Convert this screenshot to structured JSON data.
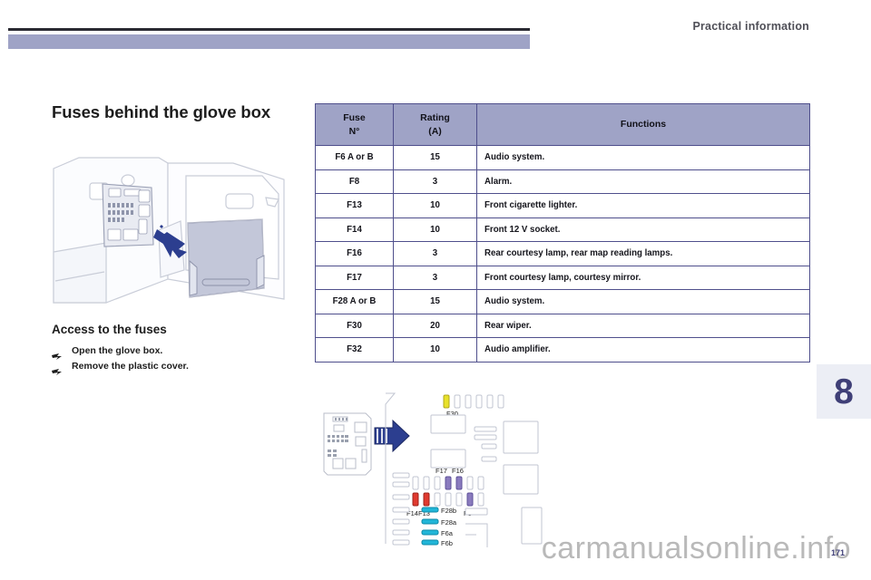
{
  "header": {
    "title": "Practical information"
  },
  "left": {
    "section_title": "Fuses behind the glove box",
    "photo_alt": "glove-box-fuse-box-illustration",
    "sub_title": "Access to the fuses",
    "steps": [
      "Open the glove box.",
      "Remove the plastic cover."
    ]
  },
  "table": {
    "columns": [
      {
        "line1": "Fuse",
        "line2": "N°"
      },
      {
        "line1": "Rating",
        "line2": "(A)"
      },
      {
        "line1": "Functions",
        "line2": ""
      }
    ],
    "rows": [
      {
        "fuse": "F6 A or B",
        "rating": "15",
        "functions": "Audio system."
      },
      {
        "fuse": "F8",
        "rating": "3",
        "functions": "Alarm."
      },
      {
        "fuse": "F13",
        "rating": "10",
        "functions": "Front cigarette lighter."
      },
      {
        "fuse": "F14",
        "rating": "10",
        "functions": "Front 12 V socket."
      },
      {
        "fuse": "F16",
        "rating": "3",
        "functions": "Rear courtesy lamp, rear map reading lamps."
      },
      {
        "fuse": "F17",
        "rating": "3",
        "functions": "Front courtesy lamp, courtesy mirror."
      },
      {
        "fuse": "F28 A or B",
        "rating": "15",
        "functions": "Audio system."
      },
      {
        "fuse": "F30",
        "rating": "20",
        "functions": "Rear wiper."
      },
      {
        "fuse": "F32",
        "rating": "10",
        "functions": "Audio amplifier."
      }
    ]
  },
  "diagram": {
    "name": "fuse-box-layout-diagram",
    "labels": [
      "F30",
      "F17",
      "F16",
      "F14",
      "F13",
      "F8",
      "F28b",
      "F28a",
      "F6a",
      "F6b"
    ],
    "fuse_colors": {
      "F30": "#e8e12a",
      "F17": "#8a7bbe",
      "F16": "#8a7bbe",
      "F14": "#e03a2f",
      "F13": "#e03a2f",
      "F8": "#8a7bbe",
      "F28b": "#21b6d8",
      "F28a": "#21b6d8",
      "F6a": "#21b6d8",
      "F6b": "#21b6d8"
    },
    "arrow_color": "#2c3e8f"
  },
  "chapter": {
    "number": "8"
  },
  "footer": {
    "page_number": "171",
    "watermark": "carmanualsonline.info"
  },
  "colors": {
    "header_band": "#9fa3c6",
    "table_header": "#9fa3c6",
    "table_border": "#4f4f8c",
    "accent": "#3f3f77",
    "text": "#1d1d1d"
  }
}
